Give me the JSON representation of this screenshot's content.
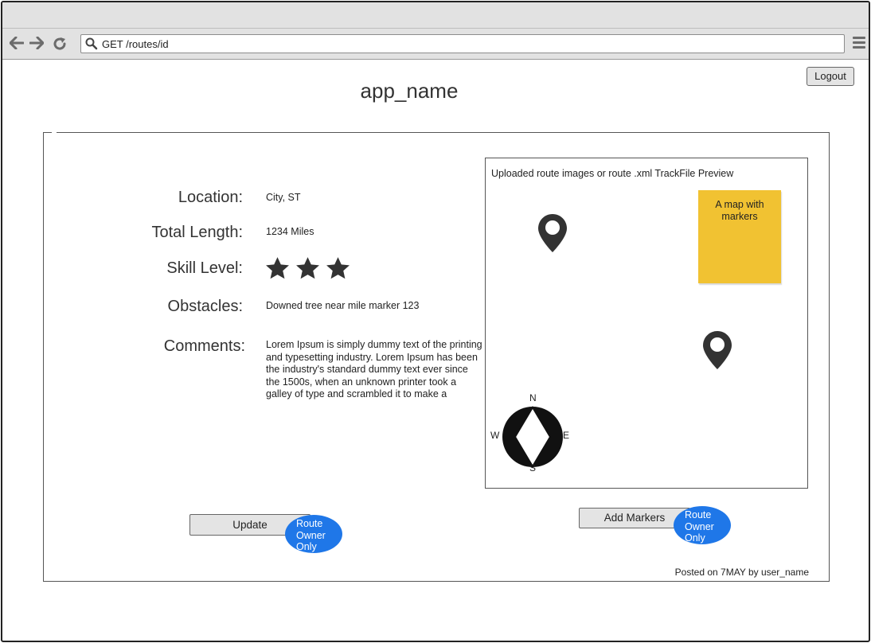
{
  "browser": {
    "url": "GET /routes/id",
    "icons": [
      "back-arrow-icon",
      "forward-arrow-icon",
      "reload-icon",
      "search-icon",
      "hamburger-menu-icon"
    ]
  },
  "header": {
    "app_name": "app_name",
    "logout_label": "Logout"
  },
  "route": {
    "labels": {
      "location": "Location:",
      "total_length": "Total Length:",
      "skill_level": "Skill Level:",
      "obstacles": "Obstacles:",
      "comments": "Comments:"
    },
    "location": "City, ST",
    "total_length": "1234 Miles",
    "skill_level": 3,
    "obstacles": "Downed tree near mile marker 123",
    "comments": "Lorem Ipsum is simply dummy text of the printing and typesetting industry. Lorem Ipsum has been the industry's standard dummy text ever since the 1500s, when an unknown printer took a galley of type and scrambled it to make a"
  },
  "preview": {
    "title": "Uploaded route images or route .xml TrackFile Preview",
    "sticky_note": "A map with markers",
    "compass": {
      "n": "N",
      "s": "S",
      "e": "E",
      "w": "W"
    }
  },
  "actions": {
    "update_label": "Update",
    "add_markers_label": "Add Markers",
    "owner_badge": "Route Owner Only"
  },
  "footer": {
    "posted": "Posted on 7MAY by user_name"
  },
  "colors": {
    "badge": "#1f77e8",
    "sticky": "#f1c232",
    "icon_dark": "#333333"
  }
}
